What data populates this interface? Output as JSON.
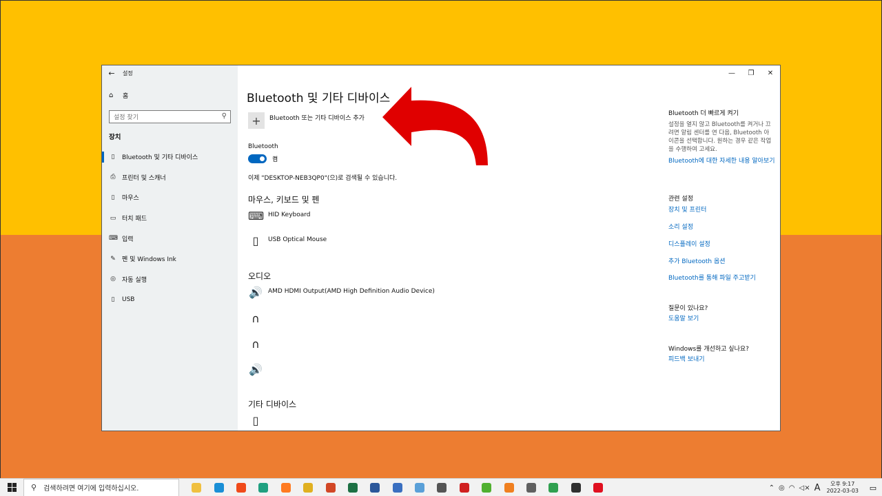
{
  "window": {
    "title": "설정",
    "back_icon": "arrow-left-icon",
    "minimize": "—",
    "restore": "❐",
    "close": "✕"
  },
  "sidebar": {
    "home_label": "홈",
    "search_placeholder": "설정 찾기",
    "section": "장치",
    "items": [
      {
        "label": "Bluetooth 및 기타 디바이스",
        "icon": "bluetooth-devices-icon"
      },
      {
        "label": "프린터 및 스캐너",
        "icon": "printer-icon"
      },
      {
        "label": "마우스",
        "icon": "mouse-icon"
      },
      {
        "label": "터치 패드",
        "icon": "touchpad-icon"
      },
      {
        "label": "입력",
        "icon": "keyboard-input-icon"
      },
      {
        "label": "펜 및 Windows Ink",
        "icon": "pen-icon"
      },
      {
        "label": "자동 실행",
        "icon": "autoplay-icon"
      },
      {
        "label": "USB",
        "icon": "usb-icon"
      }
    ]
  },
  "main": {
    "title": "Bluetooth 및 기타 디바이스",
    "add_label": "Bluetooth 또는 기타 디바이스 추가",
    "bluetooth_label": "Bluetooth",
    "toggle_state": "켬",
    "discoverable": "이제 \"DESKTOP-NEB3QP0\"(으)로 검색될 수 있습니다.",
    "mkp_header": "마우스, 키보드 및 펜",
    "mkp_devices": [
      {
        "name": "HID Keyboard",
        "icon": "keyboard-icon"
      },
      {
        "name": "USB Optical Mouse",
        "icon": "mouse-icon"
      }
    ],
    "audio_header": "오디오",
    "audio_devices": [
      {
        "name": "AMD HDMI Output(AMD High Definition Audio Device)",
        "icon": "speaker-icon"
      },
      {
        "name": "",
        "icon": "headphones-icon"
      },
      {
        "name": "",
        "icon": "headset-icon"
      },
      {
        "name": "",
        "icon": "speaker-icon"
      }
    ],
    "other_header": "기타 디바이스",
    "other_devices": [
      {
        "name": "",
        "icon": "phone-device-icon"
      }
    ]
  },
  "right": {
    "quick_header": "Bluetooth 더 빠르게 켜기",
    "quick_desc": "설정을 열지 않고 Bluetooth를 켜거나 끄려면 알림 센터를 연 다음, Bluetooth 아이콘을 선택합니다. 원하는 경우 같은 작업을 수행하여 고세요.",
    "quick_link": "Bluetooth에 대한 자세한 내용 알아보기",
    "related_header": "관련 설정",
    "related_links": [
      "장치 및 프린터",
      "소리 설정",
      "디스플레이 설정",
      "추가 Bluetooth 옵션",
      "Bluetooth를 통해 파일 주고받기"
    ],
    "question_header": "질문이 있나요?",
    "help_link": "도움말 보기",
    "improve_header": "Windows를 개선하고 싶나요?",
    "feedback_link": "피드백 보내기"
  },
  "colors": {
    "accent": "#0067c0",
    "bg_top": "#ffc000",
    "bg_bottom": "#ed7d31",
    "arrow": "#e00000"
  },
  "taskbar": {
    "search_placeholder": "검색하려면 여기에 입력하십시오.",
    "apps": [
      {
        "name": "file-explorer-icon",
        "color": "#f0c040"
      },
      {
        "name": "edge-icon",
        "color": "#1a8fd6"
      },
      {
        "name": "brave-icon",
        "color": "#f04a1a"
      },
      {
        "name": "app-green-icon",
        "color": "#20a080"
      },
      {
        "name": "firefox-icon",
        "color": "#ff7a20"
      },
      {
        "name": "chrome-icon",
        "color": "#e0b020"
      },
      {
        "name": "powerpoint-icon",
        "color": "#d24726"
      },
      {
        "name": "excel-icon",
        "color": "#1d7044"
      },
      {
        "name": "word-icon",
        "color": "#2b579a"
      },
      {
        "name": "app-grid-icon",
        "color": "#3a6fc0"
      },
      {
        "name": "app-monitor-icon",
        "color": "#5aa0d8"
      },
      {
        "name": "search-app-icon",
        "color": "#555555"
      },
      {
        "name": "app-se-icon",
        "color": "#d02020"
      },
      {
        "name": "app-download-icon",
        "color": "#50b030"
      },
      {
        "name": "vlc-icon",
        "color": "#f08020"
      },
      {
        "name": "calculator-icon",
        "color": "#606060"
      },
      {
        "name": "chrome-icon-2",
        "color": "#30a050"
      },
      {
        "name": "sticky-notes-icon",
        "color": "#303030"
      },
      {
        "name": "opera-icon",
        "color": "#e01020"
      }
    ],
    "ime": "A",
    "time": "오후 9:17",
    "date": "2022-03-03"
  }
}
